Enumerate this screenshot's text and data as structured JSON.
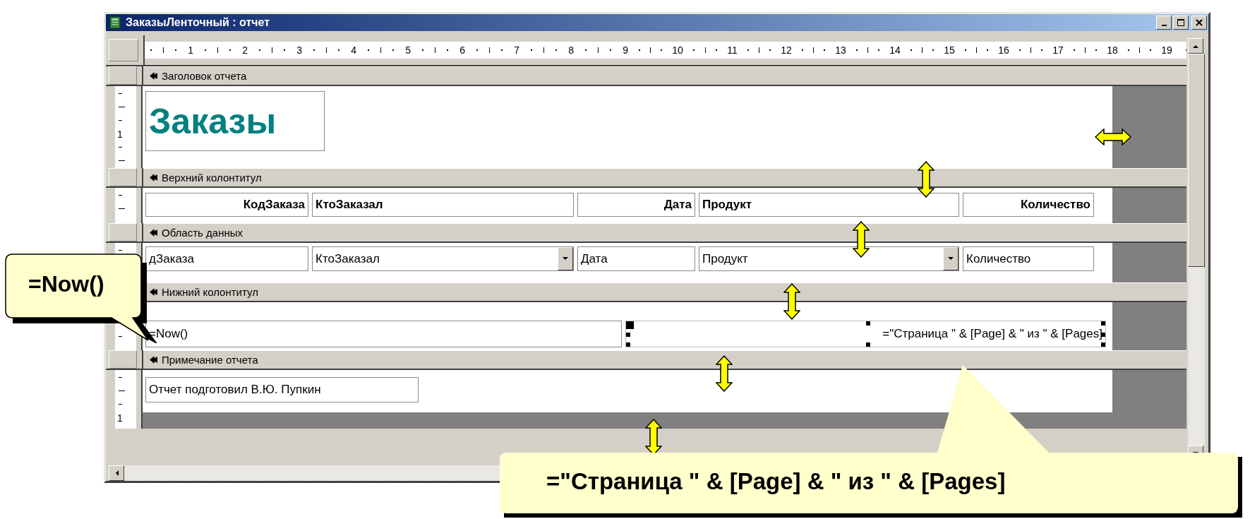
{
  "window": {
    "title": "ЗаказыЛенточный : отчет"
  },
  "ruler": {
    "labels": [
      "1",
      "2",
      "3",
      "4",
      "5",
      "6",
      "7",
      "8",
      "9",
      "10",
      "11",
      "12",
      "13",
      "14",
      "15",
      "16",
      "17",
      "18",
      "19"
    ]
  },
  "sections": [
    {
      "kind": "report_header",
      "title": "Заголовок отчета",
      "ruler_label": "1",
      "controls": [
        {
          "kind": "title",
          "text": "Заказы"
        }
      ]
    },
    {
      "kind": "page_header",
      "title": "Верхний колонтитул",
      "controls": [
        {
          "kind": "label",
          "text": "КодЗаказа"
        },
        {
          "kind": "label",
          "text": "КтоЗаказал"
        },
        {
          "kind": "label",
          "text": "Дата"
        },
        {
          "kind": "label",
          "text": "Продукт"
        },
        {
          "kind": "label",
          "text": "Количество"
        }
      ]
    },
    {
      "kind": "detail",
      "title": "Область данных",
      "controls": [
        {
          "kind": "textbox",
          "text": "дЗаказа"
        },
        {
          "kind": "combo",
          "text": "КтоЗаказал"
        },
        {
          "kind": "textbox",
          "text": "Дата"
        },
        {
          "kind": "combo",
          "text": "Продукт"
        },
        {
          "kind": "textbox",
          "text": "Количество"
        }
      ]
    },
    {
      "kind": "page_footer",
      "title": "Нижний колонтитул",
      "controls": [
        {
          "kind": "textbox",
          "text": "=Now()",
          "selected": false
        },
        {
          "kind": "textbox",
          "text": "=\"Страница \" & [Page] & \" из \" & [Pages]",
          "selected": true
        }
      ]
    },
    {
      "kind": "report_footer",
      "title": "Примечание отчета",
      "ruler_label": "1",
      "controls": [
        {
          "kind": "textbox",
          "text": "Отчет подготовил В.Ю. Пупкин"
        }
      ]
    }
  ],
  "callouts": [
    {
      "text": "=Now()"
    },
    {
      "text": "=\"Страница \" & [Page] & \" из \" & [Pages]"
    }
  ]
}
